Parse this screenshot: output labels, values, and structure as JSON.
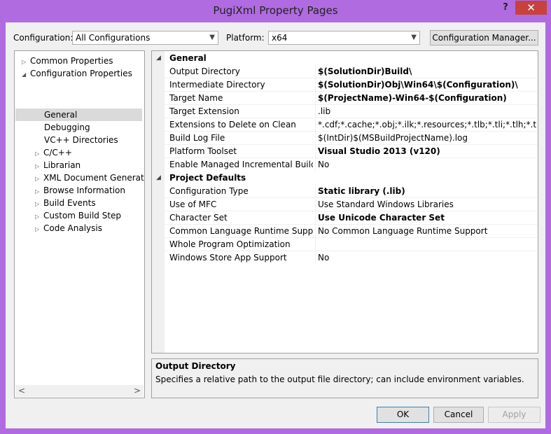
{
  "window": {
    "title": "PugiXml Property Pages",
    "help_label": "?",
    "close_label": "✕"
  },
  "toolbar": {
    "configuration_label": "Configuration:",
    "configuration_value": "All Configurations",
    "platform_label": "Platform:",
    "platform_value": "x64",
    "config_manager_label": "Configuration Manager..."
  },
  "tree": {
    "items": [
      {
        "label": "Common Properties",
        "expander": "▷"
      },
      {
        "label": "Configuration Properties",
        "expander": "◢"
      },
      {
        "label": "General",
        "expander": ""
      },
      {
        "label": "Debugging",
        "expander": ""
      },
      {
        "label": "VC++ Directories",
        "expander": ""
      },
      {
        "label": "C/C++",
        "expander": "▷"
      },
      {
        "label": "Librarian",
        "expander": "▷"
      },
      {
        "label": "XML Document Generator",
        "expander": "▷"
      },
      {
        "label": "Browse Information",
        "expander": "▷"
      },
      {
        "label": "Build Events",
        "expander": "▷"
      },
      {
        "label": "Custom Build Step",
        "expander": "▷"
      },
      {
        "label": "Code Analysis",
        "expander": "▷"
      }
    ],
    "scroll_left": "<",
    "scroll_right": ">"
  },
  "grid": {
    "cat_general": "General",
    "cat_project_defaults": "Project Defaults",
    "cat_expander": "◢",
    "general_rows": [
      {
        "name": "Output Directory",
        "value": "$(SolutionDir)Build\\",
        "bold": true
      },
      {
        "name": "Intermediate Directory",
        "value": "$(SolutionDir)Obj\\Win64\\$(Configuration)\\",
        "bold": true
      },
      {
        "name": "Target Name",
        "value": "$(ProjectName)-Win64-$(Configuration)",
        "bold": true
      },
      {
        "name": "Target Extension",
        "value": ".lib",
        "bold": false
      },
      {
        "name": "Extensions to Delete on Clean",
        "value": "*.cdf;*.cache;*.obj;*.ilk;*.resources;*.tlb;*.tli;*.tlh;*.tmp;*.rsp;",
        "bold": false
      },
      {
        "name": "Build Log File",
        "value": "$(IntDir)$(MSBuildProjectName).log",
        "bold": false
      },
      {
        "name": "Platform Toolset",
        "value": "Visual Studio 2013 (v120)",
        "bold": true
      },
      {
        "name": "Enable Managed Incremental Build",
        "value": "No",
        "bold": false
      }
    ],
    "project_rows": [
      {
        "name": "Configuration Type",
        "value": "Static library (.lib)",
        "bold": true
      },
      {
        "name": "Use of MFC",
        "value": "Use Standard Windows Libraries",
        "bold": false
      },
      {
        "name": "Character Set",
        "value": "Use Unicode Character Set",
        "bold": true
      },
      {
        "name": "Common Language Runtime Support",
        "value": "No Common Language Runtime Support",
        "bold": false
      },
      {
        "name": "Whole Program Optimization",
        "value": "",
        "bold": false
      },
      {
        "name": "Windows Store App Support",
        "value": "No",
        "bold": false
      }
    ]
  },
  "description": {
    "title": "Output Directory",
    "text": "Specifies a relative path to the output file directory; can include environment variables."
  },
  "buttons": {
    "ok": "OK",
    "cancel": "Cancel",
    "apply": "Apply"
  }
}
